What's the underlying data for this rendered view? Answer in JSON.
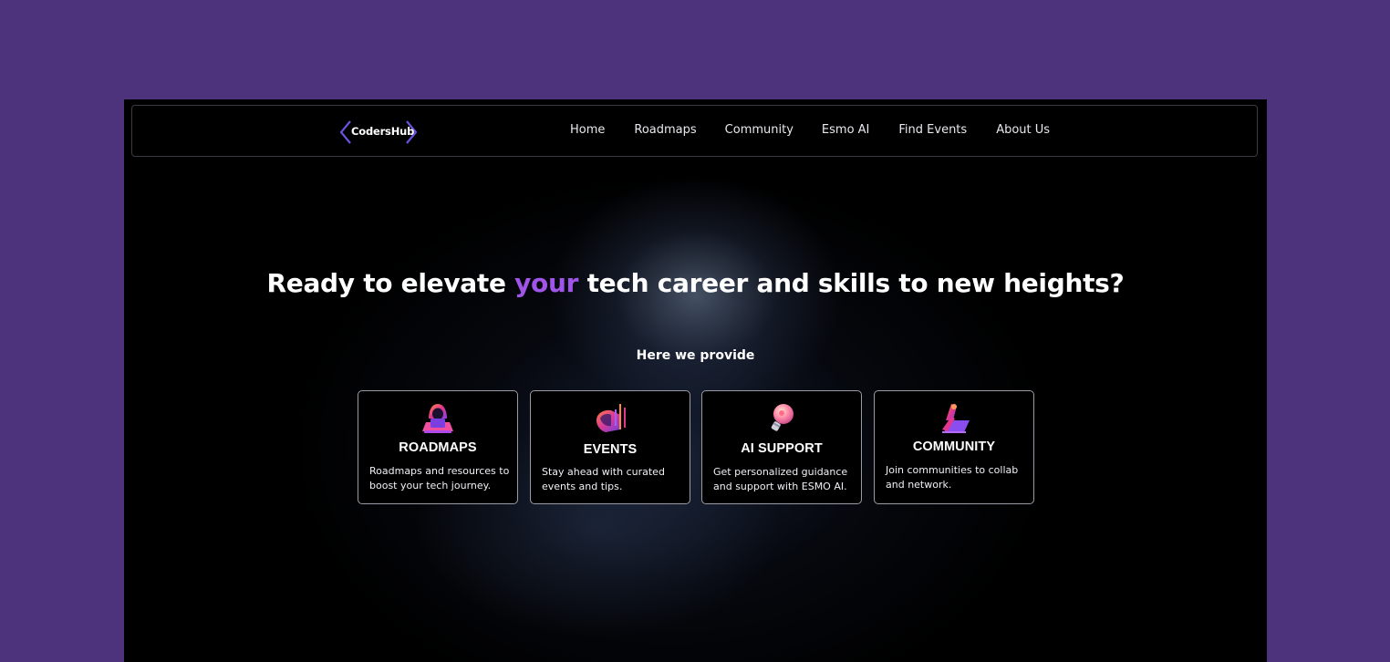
{
  "brand": {
    "name": "CodersHub",
    "accent_color": "#6b52e0"
  },
  "nav": {
    "items": [
      {
        "label": "Home"
      },
      {
        "label": "Roadmaps"
      },
      {
        "label": "Community"
      },
      {
        "label": "Esmo AI"
      },
      {
        "label": "Find Events"
      },
      {
        "label": "About Us"
      }
    ]
  },
  "hero": {
    "headline_before": "Ready to elevate ",
    "headline_accent": "your",
    "headline_after": " tech career and skills to new heights?",
    "accent_color": "#a155e8",
    "subheading": "Here we provide"
  },
  "cards": [
    {
      "icon": "hacker-laptop-icon",
      "title": "ROADMAPS",
      "description": "Roadmaps and resources to boost your tech journey."
    },
    {
      "icon": "events-chart-icon",
      "title": "EVENTS",
      "description": "Stay ahead with curated events and tips."
    },
    {
      "icon": "ai-lightbulb-icon",
      "title": "AI SUPPORT",
      "description": "Get personalized guidance and support with ESMO AI."
    },
    {
      "icon": "community-laptop-icon",
      "title": "COMMUNITY",
      "description": "Join communities to collab and network."
    }
  ],
  "colors": {
    "page_background": "#4d327c",
    "frame_background": "#000000",
    "card_border": "#9b9ba6"
  }
}
